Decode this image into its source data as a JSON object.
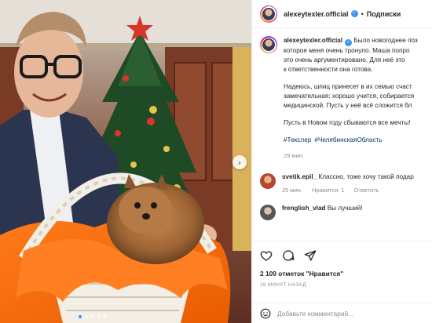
{
  "header": {
    "username": "alexeytexler.official",
    "separator": "•",
    "follow_label": "Подписки"
  },
  "caption": {
    "username": "alexeytexler.official",
    "lines": [
      "Было новогоднее поз",
      "которое меня очень тронуло. Маша попро",
      "это очень аргументировано. Для неё это",
      "к ответственности она готова."
    ],
    "paragraph2": [
      "Надеюсь, шпиц принесет в их семью счаст",
      "замечательная: хорошо учится, собирается",
      "медицинской. Пусть у неё всё сложится бл"
    ],
    "paragraph3": "Пусть в Новом году сбываются все мечты!",
    "hashtags": [
      "#Текслер",
      "#ЧелябинскаяОбласть"
    ],
    "time": "29 мин."
  },
  "comments": [
    {
      "username": "svetik.epil_",
      "text": "Классно, тоже хочу такой подар",
      "time": "25 мин.",
      "likes": "Нравится: 1",
      "reply_label": "Ответить"
    },
    {
      "username": "frenglish_vlad",
      "text": "Вы лучший!"
    }
  ],
  "footer": {
    "likes_text": "2 109 отметок \"Нравится\"",
    "timestamp": "29 МИНУТ НАЗАД",
    "comment_placeholder": "Добавьте комментарий..."
  },
  "icons": {
    "like": "heart-icon",
    "comment": "comment-icon",
    "share": "share-icon",
    "emoji": "emoji-icon",
    "next": "chevron-right-icon",
    "verified": "verified-badge-icon"
  },
  "colors": {
    "link": "#00376b",
    "verified": "#3897f0",
    "secondary_text": "#8e8e8e",
    "border": "#efefef"
  },
  "carousel": {
    "slide_count": 5,
    "active_index": 0
  }
}
